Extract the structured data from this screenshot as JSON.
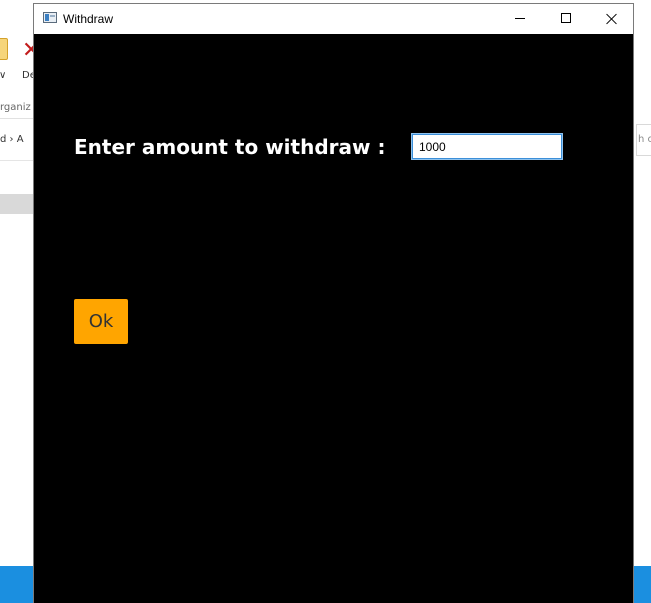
{
  "window": {
    "title": "Withdraw"
  },
  "form": {
    "prompt": "Enter amount to withdraw :",
    "amount_value": "1000"
  },
  "actions": {
    "ok_label": "Ok"
  },
  "background": {
    "ribbon_delete_label": "De",
    "ribbon_left_label": "∨",
    "organize_label": "rganiz",
    "address_fragment": "d › A",
    "search_fragment": "h c"
  },
  "colors": {
    "content_background": "#000000",
    "ok_button": "#ffa500",
    "input_focus_border": "#3c8fd8",
    "taskbar": "#1b8fe0"
  },
  "icons": {
    "app_icon": "window-app-icon",
    "minimize": "minimize-icon",
    "maximize": "maximize-icon",
    "close": "close-icon"
  }
}
